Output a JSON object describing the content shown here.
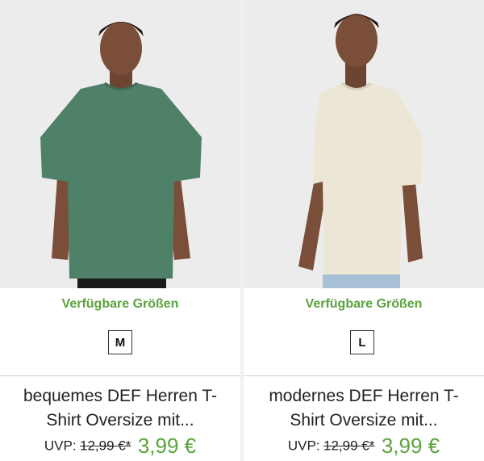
{
  "products": [
    {
      "image_alt": "Man wearing green oversize t-shirt",
      "shirt_color": "#4f8068",
      "sizes_heading": "Verfügbare Größen",
      "size": "M",
      "title_line1": "bequemes DEF Herren T-",
      "title_line2": "Shirt Oversize mit...",
      "uvp_label": "UVP:",
      "old_price": "12,99 €*",
      "new_price": "3,99 €"
    },
    {
      "image_alt": "Man wearing beige oversize t-shirt",
      "shirt_color": "#ece6d6",
      "sizes_heading": "Verfügbare Größen",
      "size": "L",
      "title_line1": "modernes DEF Herren T-",
      "title_line2": "Shirt Oversize mit...",
      "uvp_label": "UVP:",
      "old_price": "12,99 €*",
      "new_price": "3,99 €"
    }
  ],
  "colors": {
    "accent_green": "#5aa33d"
  }
}
